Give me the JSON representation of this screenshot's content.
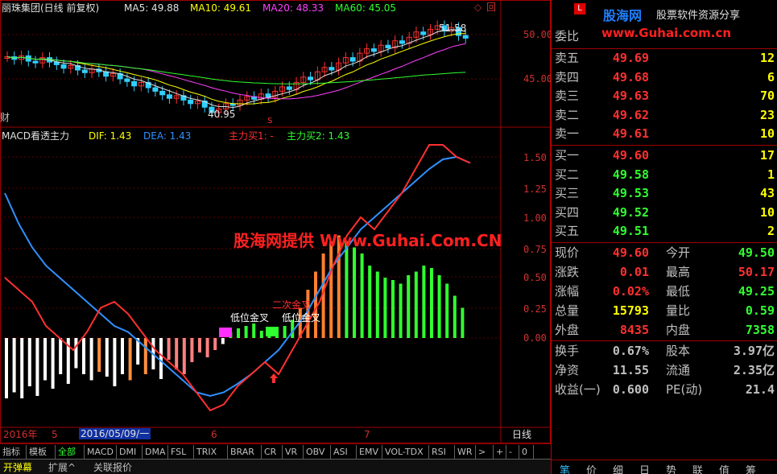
{
  "header": {
    "stock": "丽珠集团(日线 前复权)",
    "ma5": "MA5: 49.88",
    "ma10": "MA10: 49.61",
    "ma20": "MA20: 48.33",
    "ma60": "MA60: 45.05",
    "corner_icon": "◇",
    "corner_icon2": "回",
    "side_char": "财"
  },
  "price_panel": {
    "yticks": [
      "50.00",
      "45.00"
    ],
    "high_label": "51.58",
    "low_label": "40.95",
    "s_marker": "S"
  },
  "macd_header": {
    "name": "MACD看透主力",
    "dif": "DIF: 1.43",
    "dea": "DEA: 1.43",
    "buy1": "主力买1: -",
    "buy2": "主力买2: 1.43"
  },
  "macd_panel": {
    "yticks": [
      "1.50",
      "1.25",
      "1.00",
      "0.75",
      "0.50",
      "0.25",
      "0.00"
    ],
    "annotation1": "低位金叉",
    "annotation2": "二次金叉",
    "annotation3": "低位金叉"
  },
  "watermark_center": "股海网提供 Www.Guhai.Com.CN",
  "xaxis": {
    "year": "2016年",
    "m5": "5",
    "cursor_date": "2016/05/09/一",
    "m6": "6",
    "m7": "7",
    "period": "日线"
  },
  "tabs": [
    "指标",
    "模板",
    "全部",
    "MACD",
    "DMI",
    "DMA",
    "FSL",
    "TRIX",
    "BRAR",
    "CR",
    "VR",
    "OBV",
    "ASI",
    "EMV",
    "VOL-TDX",
    "RSI",
    "WR",
    ">",
    "+",
    "-",
    "0"
  ],
  "bottom_tabs": [
    "开弹幕",
    "扩展^",
    "关联报价"
  ],
  "right": {
    "logo_text": "股海网",
    "logo_sub": "股票软件资源分享",
    "site": "www.Guhai.com.cn",
    "weibi_label": "委比",
    "sells": [
      {
        "name": "卖五",
        "price": "49.69",
        "vol": "12"
      },
      {
        "name": "卖四",
        "price": "49.68",
        "vol": "6"
      },
      {
        "name": "卖三",
        "price": "49.63",
        "vol": "70"
      },
      {
        "name": "卖二",
        "price": "49.62",
        "vol": "23"
      },
      {
        "name": "卖一",
        "price": "49.61",
        "vol": "10"
      }
    ],
    "buys": [
      {
        "name": "买一",
        "price": "49.60",
        "vol": "17"
      },
      {
        "name": "买二",
        "price": "49.58",
        "vol": "1"
      },
      {
        "name": "买三",
        "price": "49.53",
        "vol": "43"
      },
      {
        "name": "买四",
        "price": "49.52",
        "vol": "10"
      },
      {
        "name": "买五",
        "price": "49.51",
        "vol": "2"
      }
    ],
    "stats": [
      {
        "l1": "现价",
        "v1": "49.60",
        "c1": "#ff3030",
        "l2": "今开",
        "v2": "49.50",
        "c2": "#30ff30"
      },
      {
        "l1": "涨跌",
        "v1": "0.01",
        "c1": "#ff3030",
        "l2": "最高",
        "v2": "50.17",
        "c2": "#ff3030"
      },
      {
        "l1": "涨幅",
        "v1": "0.02%",
        "c1": "#ff3030",
        "l2": "最低",
        "v2": "49.25",
        "c2": "#30ff30"
      },
      {
        "l1": "总量",
        "v1": "15793",
        "c1": "#ffff00",
        "l2": "量比",
        "v2": "0.59",
        "c2": "#30ff30"
      },
      {
        "l1": "外盘",
        "v1": "8435",
        "c1": "#ff3030",
        "l2": "内盘",
        "v2": "7358",
        "c2": "#30ff30"
      }
    ],
    "stats2": [
      {
        "l1": "换手",
        "v1": "0.67%",
        "c1": "#c0c0c0",
        "l2": "股本",
        "v2": "3.97亿",
        "c2": "#c0c0c0"
      },
      {
        "l1": "净资",
        "v1": "11.55",
        "c1": "#c0c0c0",
        "l2": "流通",
        "v2": "2.35亿",
        "c2": "#c0c0c0"
      },
      {
        "l1": "收益(一)",
        "v1": "0.600",
        "c1": "#c0c0c0",
        "l2": "PE(动)",
        "v2": "21.4",
        "c2": "#c0c0c0"
      }
    ],
    "bottom_tabs": [
      "笔",
      "价",
      "细",
      "日",
      "势",
      "联",
      "值",
      "筹"
    ]
  }
}
